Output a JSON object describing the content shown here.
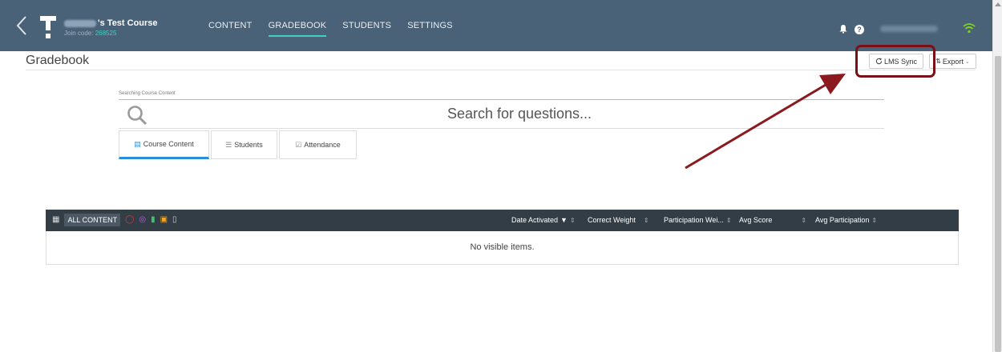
{
  "topbar": {
    "course_title": "'s Test Course",
    "join_label": "Join code: ",
    "join_code": "268525",
    "nav": [
      {
        "label": "CONTENT"
      },
      {
        "label": "GRADEBOOK"
      },
      {
        "label": "STUDENTS"
      },
      {
        "label": "SETTINGS"
      }
    ],
    "active_tab": "GRADEBOOK",
    "help_glyph": "?",
    "icons": [
      "chevron-left-icon",
      "app-logo-icon",
      "bell-icon",
      "help-icon",
      "wifi-icon"
    ],
    "accent_color": "#3fd0c4",
    "bar_color": "#4a6278"
  },
  "page": {
    "title": "Gradebook",
    "lms_sync_label": "LMS Sync",
    "export_label": "Export",
    "highlight_color": "#7a1016"
  },
  "search": {
    "label": "Searching Course Content",
    "placeholder": "Search for questions..."
  },
  "tabs": [
    {
      "label": "Course Content",
      "icon": "document-icon"
    },
    {
      "label": "Students",
      "icon": "list-icon"
    },
    {
      "label": "Attendance",
      "icon": "checkbox-icon"
    }
  ],
  "table": {
    "filter_all": "ALL CONTENT",
    "columns": [
      {
        "label": "Date Activated"
      },
      {
        "label": "Correct Weight"
      },
      {
        "label": "Participation Wei..."
      },
      {
        "label": "Avg Score"
      },
      {
        "label": "Avg Participation"
      }
    ],
    "empty_message": "No visible items."
  }
}
